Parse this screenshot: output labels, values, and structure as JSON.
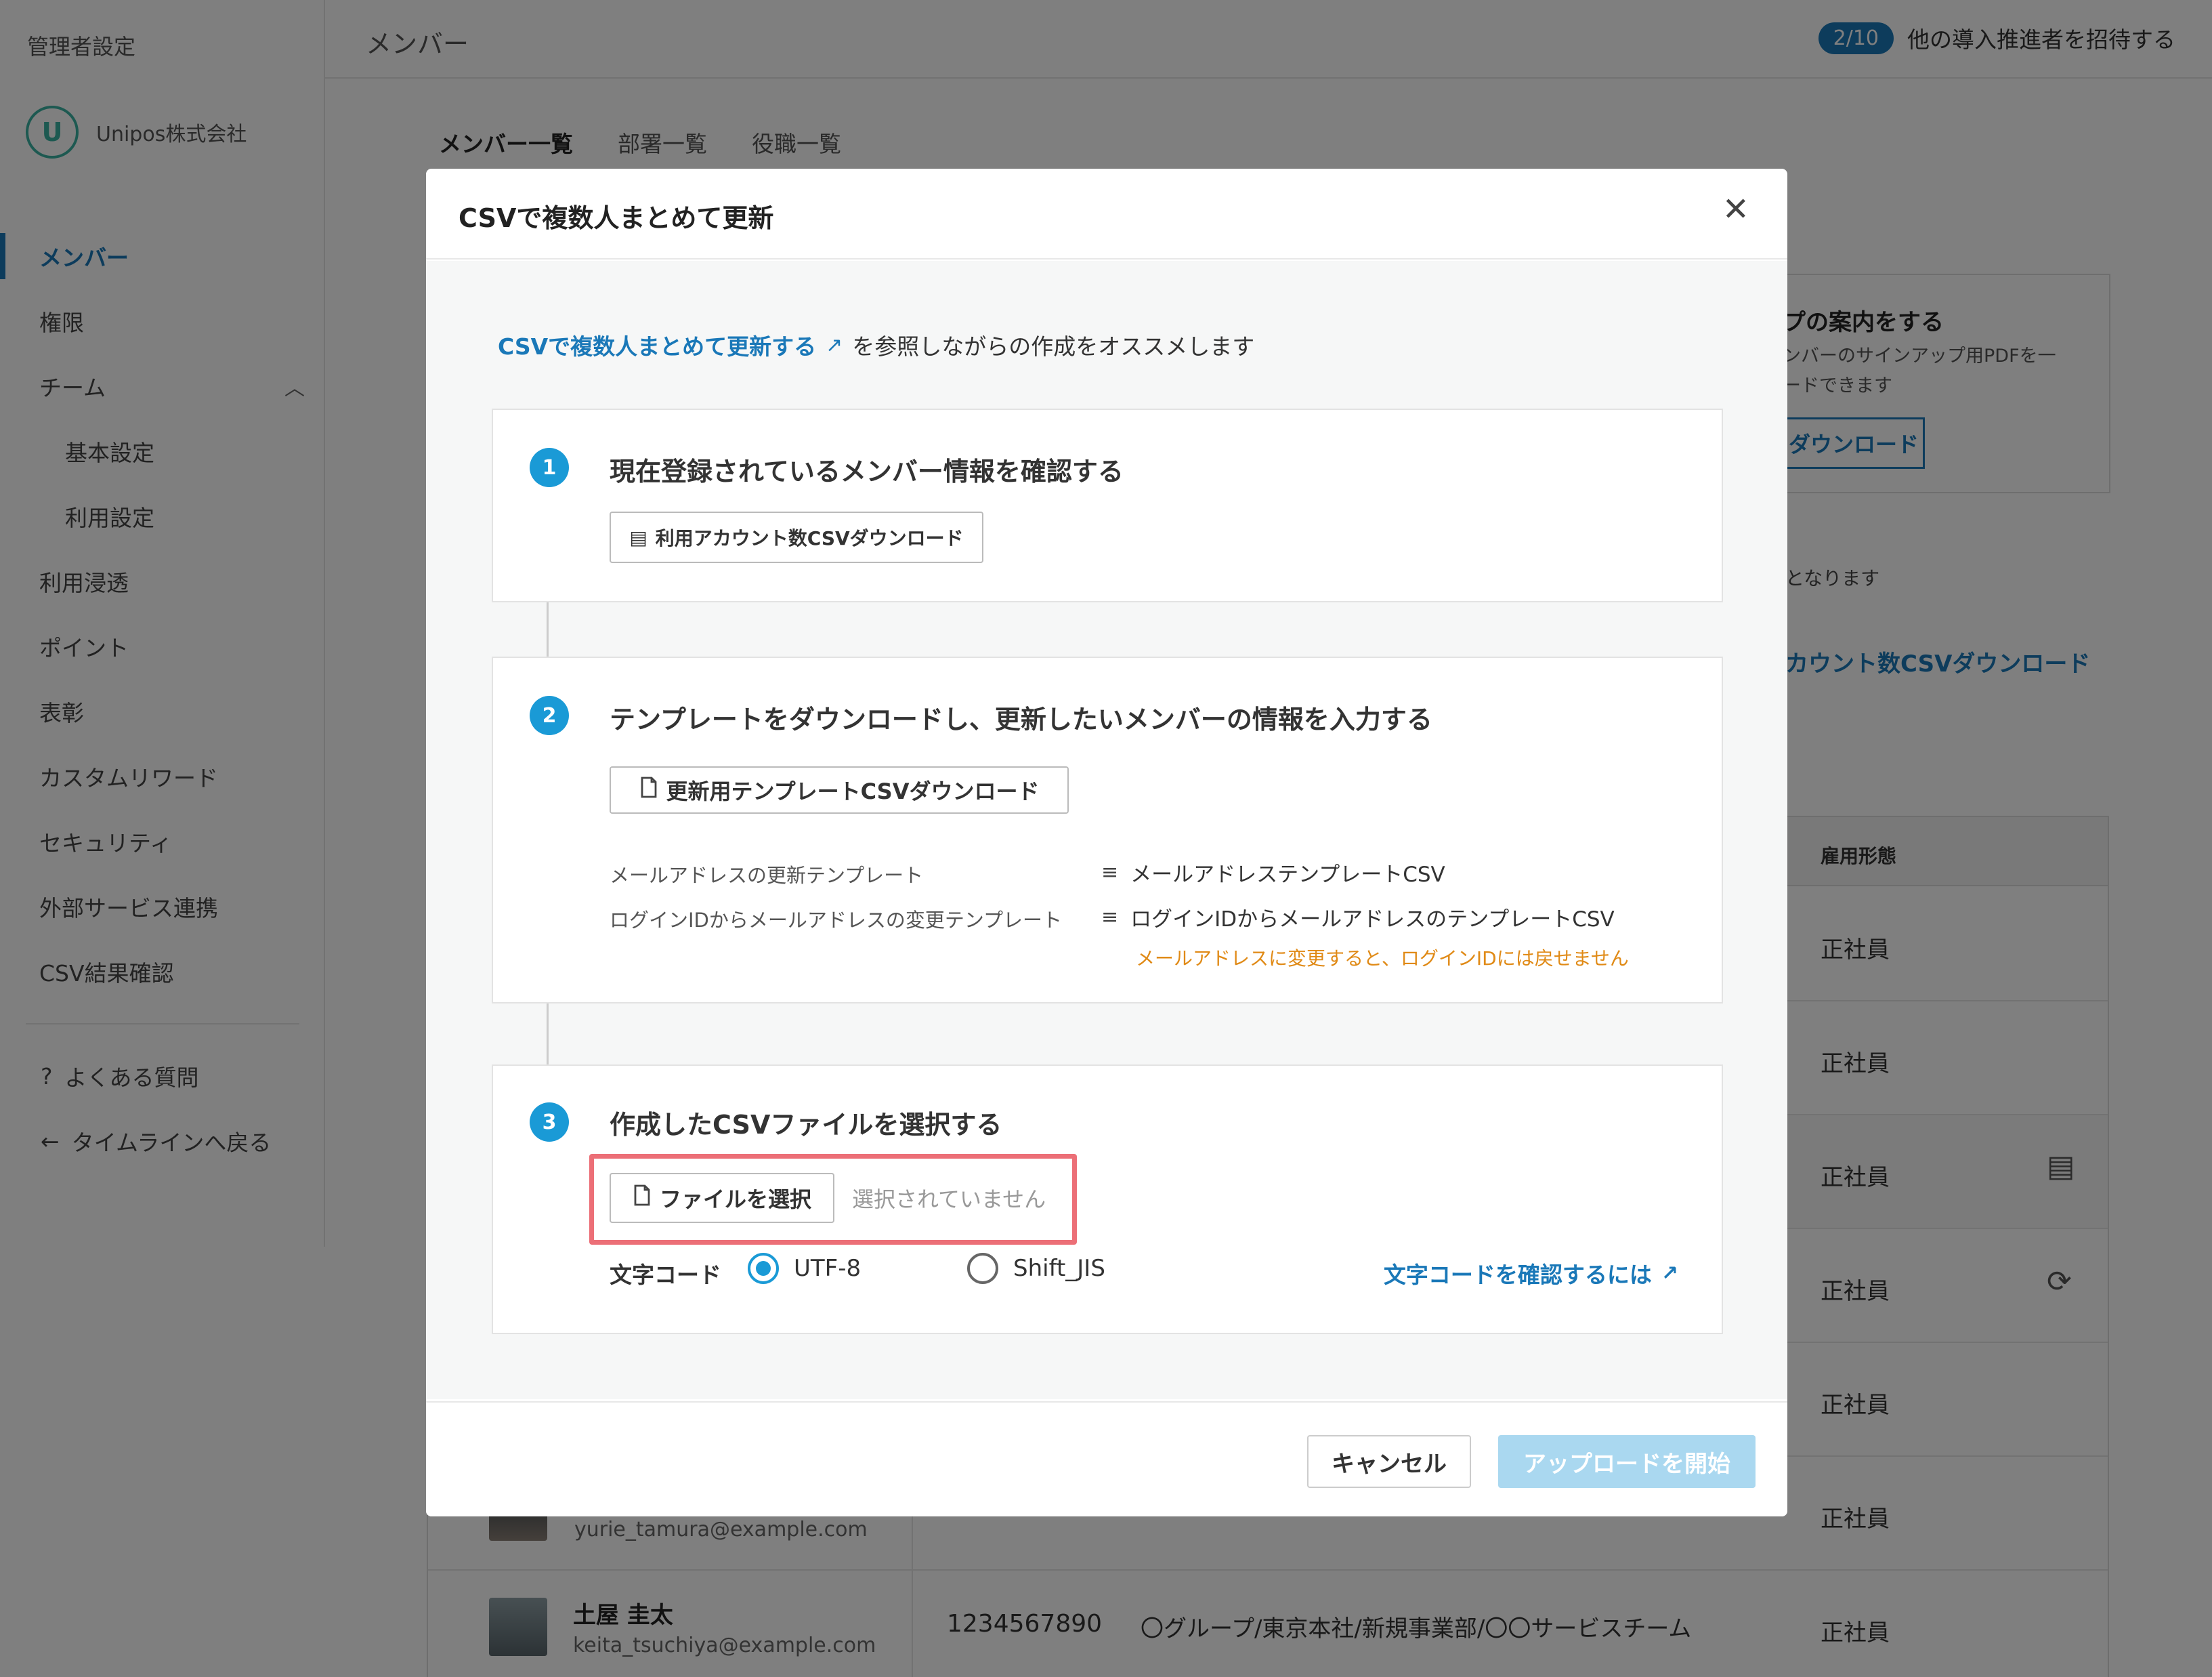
{
  "sidebar": {
    "title": "管理者設定",
    "org_logo": "U",
    "org_name": "Unipos株式会社",
    "items": [
      {
        "label": "メンバー",
        "active": true
      },
      {
        "label": "権限"
      },
      {
        "label": "チーム"
      },
      {
        "label": "基本設定"
      },
      {
        "label": "利用設定"
      },
      {
        "label": "利用浸透"
      },
      {
        "label": "ポイント"
      },
      {
        "label": "表彰"
      },
      {
        "label": "カスタムリワード"
      },
      {
        "label": "セキュリティ"
      },
      {
        "label": "外部サービス連携"
      },
      {
        "label": "CSV結果確認"
      }
    ],
    "faq": "よくある質問",
    "back": "タイムラインへ戻る"
  },
  "header": {
    "title": "メンバー",
    "invite_badge": "2/10",
    "invite_text": "他の導入推進者を招待する"
  },
  "tabs": [
    "メンバー一覧",
    "部署一覧",
    "役職一覧"
  ],
  "side_card": {
    "title": "プの案内をする",
    "desc1": "ンバーのサインアップ用PDFを一",
    "desc2": "ードできます",
    "button": "ダウンロード"
  },
  "bg_note": "となります",
  "bg_link": "カウント数CSVダウンロード",
  "table": {
    "header_emp": "雇用形態",
    "emp": "正社員",
    "person_top_mail": "yurie_tamura@example.com",
    "person": {
      "name": "土屋 圭太",
      "mail": "keita_tsuchiya@example.com",
      "id": "1234567890",
      "dept": "〇グループ/東京本社/新規事業部/〇〇サービスチーム"
    }
  },
  "modal": {
    "title": "CSVで複数人まとめて更新",
    "intro_link": "CSVで複数人まとめて更新する",
    "intro_text": "を参照しながらの作成をオススメします",
    "step1": {
      "num": "1",
      "title": "現在登録されているメンバー情報を確認する",
      "button": "利用アカウント数CSVダウンロード"
    },
    "step2": {
      "num": "2",
      "title": "テンプレートをダウンロードし、更新したいメンバーの情報を入力する",
      "button": "更新用テンプレートCSVダウンロード",
      "row1_label": "メールアドレスの更新テンプレート",
      "row1_link": "メールアドレステンプレートCSV",
      "row2_label": "ログインIDからメールアドレスの変更テンプレート",
      "row2_link": "ログインIDからメールアドレスのテンプレートCSV",
      "warning": "メールアドレスに変更すると、ログインIDには戻せません"
    },
    "step3": {
      "num": "3",
      "title": "作成したCSVファイルを選択する",
      "file_button": "ファイルを選択",
      "file_status": "選択されていません",
      "encoding_label": "文字コード",
      "utf8": "UTF-8",
      "sjis": "Shift_JIS",
      "encoding_link": "文字コードを確認するには"
    },
    "cancel": "キャンセル",
    "upload": "アップロードを開始"
  },
  "colors": {
    "accent": "#1a78b8",
    "step_badge": "#1a9ad6",
    "warning": "#e08a16",
    "highlight": "#ec6f77",
    "upload_disabled": "#aad8f0"
  }
}
